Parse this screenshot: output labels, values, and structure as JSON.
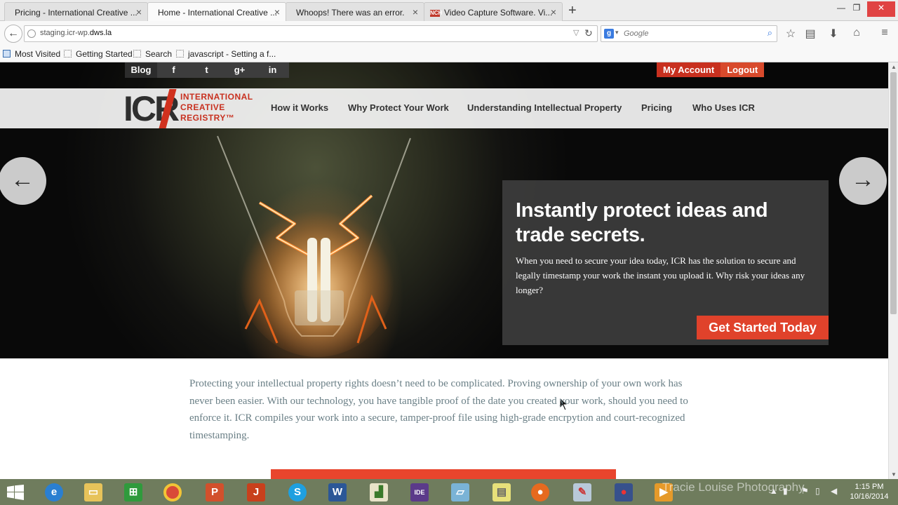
{
  "browser": {
    "tabs": [
      {
        "label": "Pricing - International Creative ...",
        "active": false
      },
      {
        "label": "Home - International Creative ...",
        "active": true
      },
      {
        "label": "Whoops! There was an error.",
        "active": false
      },
      {
        "label": "Video Capture Software. Vi...",
        "active": false
      }
    ],
    "url_prefix": "staging.icr-wp.",
    "url_domain": "dws.la",
    "search_placeholder": "Google",
    "bookmarks": [
      "Most Visited",
      "Getting Started",
      "Search",
      "javascript - Setting a f..."
    ]
  },
  "site": {
    "topbar": {
      "blog": "Blog",
      "facebook": "f",
      "twitter": "t",
      "gplus": "g+",
      "linkedin": "in",
      "my_account": "My Account",
      "logout": "Logout"
    },
    "logo": {
      "letters": "ICR",
      "line1": "INTERNATIONAL",
      "line2": "CREATIVE",
      "line3": "REGISTRY™"
    },
    "nav": [
      "How it Works",
      "Why Protect Your Work",
      "Understanding Intellectual Property",
      "Pricing",
      "Who Uses ICR"
    ],
    "hero": {
      "headline": "Instantly protect ideas and trade secrets.",
      "body": "When you need to secure your idea today, ICR has the solution to secure and legally timestamp your work the instant you upload it. Why risk your ideas any longer?",
      "cta": "Get Started Today"
    },
    "intro": "Protecting your intellectual property rights doesn’t need to be complicated. Proving ownership of your own work has never been easier. With our technology, you have tangible proof of the date you created your work, should you need to enforce it. ICR compiles your work into a secure, tamper-proof file using high-grade encrpytion and court-recognized timestamping."
  },
  "taskbar": {
    "time": "1:15 PM",
    "date": "10/16/2014",
    "watermark": "Tracie Louise Photography"
  },
  "colors": {
    "brand_red": "#c8301f",
    "cta_red": "#e0422b",
    "taskbar": "#6f7c5d"
  }
}
